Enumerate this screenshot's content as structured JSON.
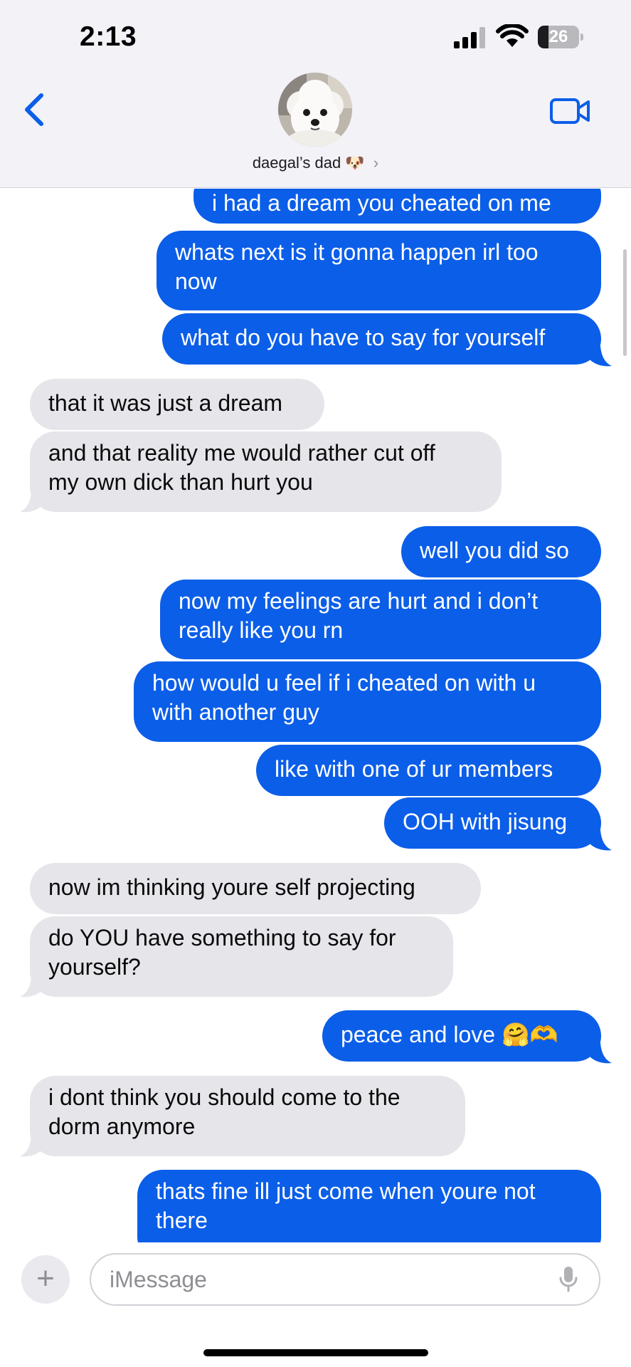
{
  "status_bar": {
    "time": "2:13",
    "battery": "26",
    "battery_level": 0.26,
    "icons": [
      "signal-bars-icon",
      "wifi-icon",
      "battery-icon"
    ]
  },
  "header": {
    "back_icon": "chevron-left-icon",
    "contact_name": "daegal’s dad",
    "contact_emoji": "🐶",
    "chevron": "›",
    "video_icon": "video-camera-icon",
    "accent_color": "#0b5ee8"
  },
  "messages": [
    {
      "from": "me",
      "text": "i had a dream you cheated on me"
    },
    {
      "from": "me",
      "text": "whats next is it gonna happen irl too\nnow"
    },
    {
      "from": "me",
      "text": "what do you have to say for yourself"
    },
    {
      "from": "them",
      "text": "that it was just a dream"
    },
    {
      "from": "them",
      "text": "and that reality me would rather cut off\nmy own dick than hurt you"
    },
    {
      "from": "me",
      "text": "well you did so"
    },
    {
      "from": "me",
      "text": "now my feelings are hurt and i don’t\nreally like you rn"
    },
    {
      "from": "me",
      "text": "how would u feel if i cheated on with u\nwith another guy"
    },
    {
      "from": "me",
      "text": "like with one of ur members"
    },
    {
      "from": "me",
      "text": "OOH with jisung"
    },
    {
      "from": "them",
      "text": "now im thinking youre self projecting"
    },
    {
      "from": "them",
      "text": "do YOU have something to say for\nyourself?"
    },
    {
      "from": "me",
      "text": "peace and love 🤗🫶"
    },
    {
      "from": "them",
      "text": "i dont think you should come to the\ndorm anymore"
    },
    {
      "from": "me",
      "text": "thats fine ill just come when youre not\nthere"
    }
  ],
  "colors": {
    "sent_bubble": "#0b5ee8",
    "received_bubble": "#e5e5ea"
  },
  "composer": {
    "plus_label": "+",
    "placeholder": "iMessage",
    "mic_icon": "microphone-icon"
  }
}
